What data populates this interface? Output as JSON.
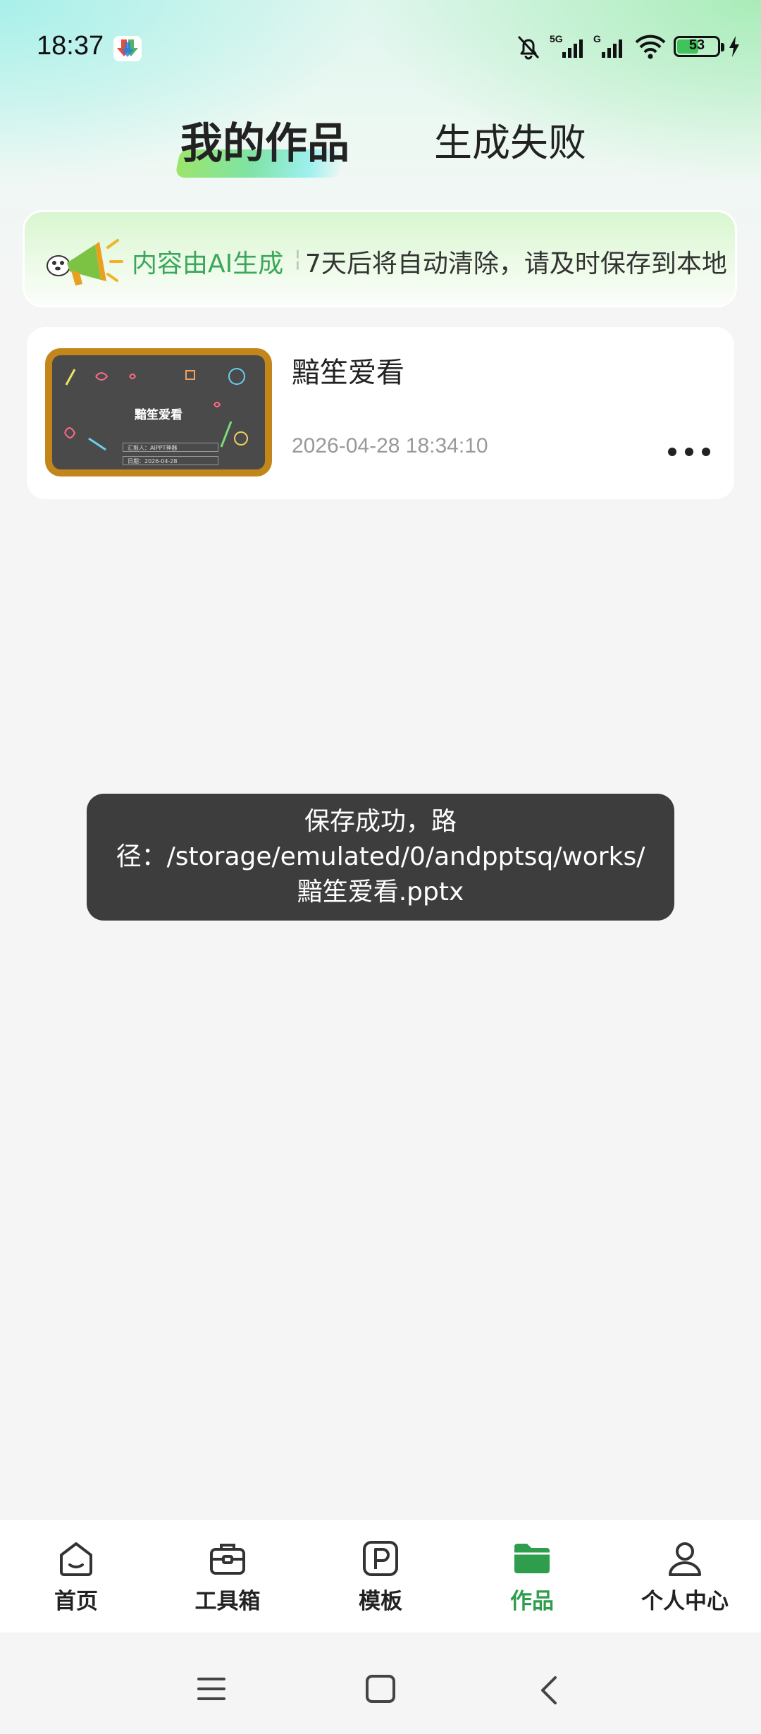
{
  "status_bar": {
    "time": "18:37",
    "network_5g": "5G",
    "network_g": "G",
    "battery_level": "53",
    "battery_fraction": 0.53
  },
  "tabs": [
    {
      "label": "我的作品",
      "active": true
    },
    {
      "label": "生成失败",
      "active": false
    }
  ],
  "notice": {
    "highlight": "内容由AI生成",
    "text": "7天后将自动清除，请及时保存到本地"
  },
  "work": {
    "title": "黯笙爱看",
    "date": "2026-04-28 18:34:10",
    "thumbnail": {
      "title": "黯笙爱看",
      "line1": "汇报人：AIPPT神器",
      "line2": "日期：2026-04-28"
    }
  },
  "toast": {
    "message": "保存成功，路径：/storage/emulated/0/andpptsq/works/黯笙爱看.pptx"
  },
  "bottom_nav": [
    {
      "label": "首页",
      "icon": "home-icon",
      "active": false
    },
    {
      "label": "工具箱",
      "icon": "toolbox-icon",
      "active": false
    },
    {
      "label": "模板",
      "icon": "template-icon",
      "active": false
    },
    {
      "label": "作品",
      "icon": "folder-icon",
      "active": true
    },
    {
      "label": "个人中心",
      "icon": "user-icon",
      "active": false
    }
  ],
  "colors": {
    "accent": "#2f9e4c",
    "notice_green": "#3aa75a",
    "toast_bg": "#3d3d3d"
  }
}
